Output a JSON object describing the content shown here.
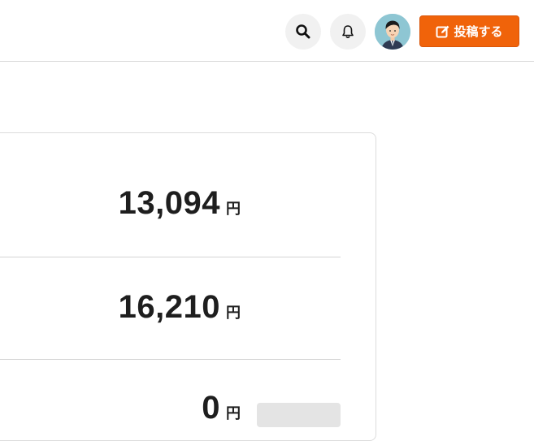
{
  "header": {
    "post_button_label": "投稿する",
    "icons": [
      "search-icon",
      "bell-icon",
      "avatar",
      "edit-icon"
    ],
    "accent_color": "#f0630a"
  },
  "summary": {
    "rows": [
      {
        "value": "13,094",
        "unit": "円"
      },
      {
        "value": "16,210",
        "unit": "円"
      },
      {
        "value": "0",
        "unit": "円"
      }
    ]
  }
}
